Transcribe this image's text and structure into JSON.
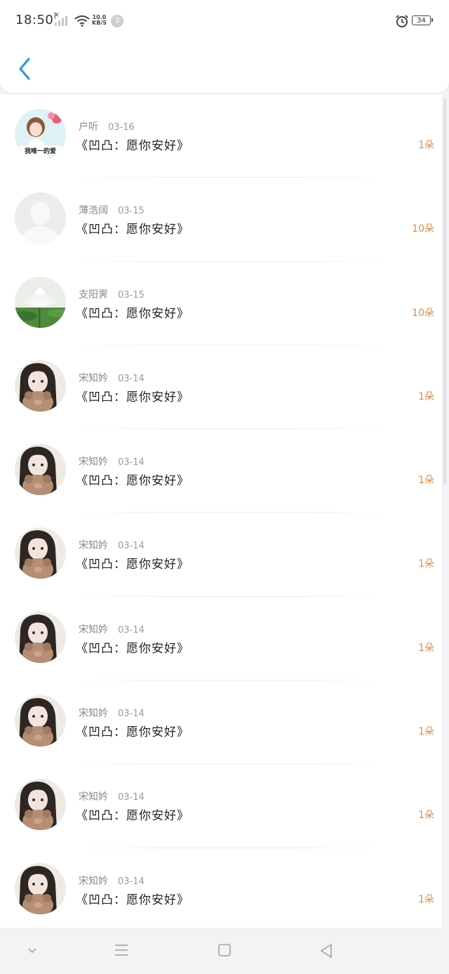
{
  "status_bar": {
    "time": "18:50",
    "net_speed_top": "10.0",
    "net_speed_bottom": "KB/S",
    "notification_count": "3",
    "battery": "34"
  },
  "header": {
    "back_icon": "chevron-left-icon",
    "accent": "#2c9be6"
  },
  "items": [
    {
      "user": "户听",
      "date": "03-16",
      "title": "《凹凸：愿你安好》",
      "count": "1朵",
      "avatar": "girl-sticker",
      "avatar_caption": "我唯一的爱"
    },
    {
      "user": "薄浩阔",
      "date": "03-15",
      "title": "《凹凸：愿你安好》",
      "count": "10朵",
      "avatar": "default"
    },
    {
      "user": "支阳霁",
      "date": "03-15",
      "title": "《凹凸：愿你安好》",
      "count": "10朵",
      "avatar": "lotus"
    },
    {
      "user": "宋知妗",
      "date": "03-14",
      "title": "《凹凸：愿你安好》",
      "count": "1朵",
      "avatar": "girl-bear"
    },
    {
      "user": "宋知妗",
      "date": "03-14",
      "title": "《凹凸：愿你安好》",
      "count": "1朵",
      "avatar": "girl-bear"
    },
    {
      "user": "宋知妗",
      "date": "03-14",
      "title": "《凹凸：愿你安好》",
      "count": "1朵",
      "avatar": "girl-bear"
    },
    {
      "user": "宋知妗",
      "date": "03-14",
      "title": "《凹凸：愿你安好》",
      "count": "1朵",
      "avatar": "girl-bear"
    },
    {
      "user": "宋知妗",
      "date": "03-14",
      "title": "《凹凸：愿你安好》",
      "count": "1朵",
      "avatar": "girl-bear"
    },
    {
      "user": "宋知妗",
      "date": "03-14",
      "title": "《凹凸：愿你安好》",
      "count": "1朵",
      "avatar": "girl-bear"
    },
    {
      "user": "宋知妗",
      "date": "03-14",
      "title": "《凹凸：愿你安好》",
      "count": "1朵",
      "avatar": "girl-bear"
    }
  ],
  "colors": {
    "count": "#e8893b",
    "title": "#222222",
    "meta": "#8a8a8a"
  },
  "nav_bar": {
    "icons": [
      "chevron-down-icon",
      "menu-icon",
      "home-square-icon",
      "back-triangle-icon"
    ]
  }
}
